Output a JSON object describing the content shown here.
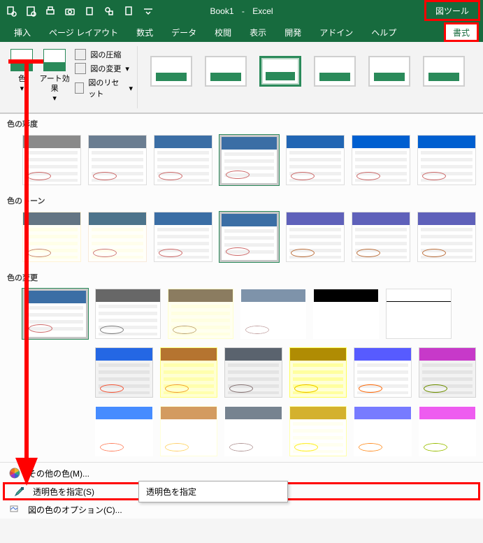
{
  "titlebar": {
    "doc_name": "Book1",
    "app_name": "Excel",
    "contextual_label": "図ツール"
  },
  "qat": {
    "print_preview": "印刷プレビュー",
    "new_file": "新規",
    "quick_print": "クイック印刷",
    "screenshot": "スクリーンショット",
    "paste": "貼り付け",
    "shapes": "図形",
    "new_blank": "新規",
    "more": "その他"
  },
  "tabs": {
    "insert": "挿入",
    "page_layout": "ページ レイアウト",
    "formulas": "数式",
    "data": "データ",
    "review": "校閲",
    "view": "表示",
    "developer": "開発",
    "addins": "アドイン",
    "help": "ヘルプ",
    "format": "書式"
  },
  "ribbon": {
    "color_btn": "色",
    "artistic_btn": "アート効果",
    "compress": "図の圧縮",
    "change": "図の変更",
    "reset": "図のリセット"
  },
  "panel": {
    "saturation_title": "色の彩度",
    "tone_title": "色のトーン",
    "recolor_title": "色の変更",
    "more_colors": "その他の色(M)...",
    "set_transparent": "透明色を指定(S)",
    "color_options": "図の色のオプション(C)..."
  },
  "tooltip": {
    "text": "透明色を指定"
  }
}
